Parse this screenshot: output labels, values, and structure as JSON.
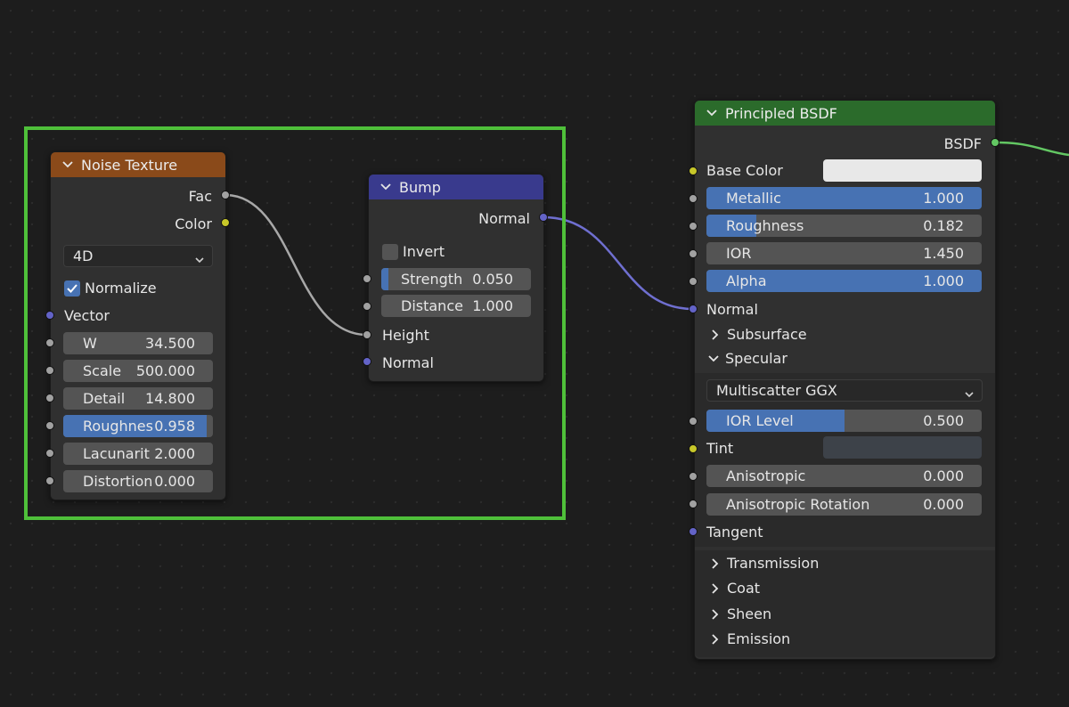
{
  "noise_node": {
    "title": "Noise Texture",
    "header_color": "#8a4a1a",
    "outputs": [
      "Fac",
      "Color"
    ],
    "dimension": "4D",
    "normalize_label": "Normalize",
    "normalize_checked": true,
    "vector_label": "Vector",
    "fields": [
      {
        "label": "W",
        "value": "34.500"
      },
      {
        "label": "Scale",
        "value": "500.000"
      },
      {
        "label": "Detail",
        "value": "14.800"
      },
      {
        "label": "Roughnes",
        "value": "0.958",
        "fill": 0.958
      },
      {
        "label": "Lacunarit",
        "value": "2.000"
      },
      {
        "label": "Distortion",
        "value": "0.000"
      }
    ]
  },
  "bump_node": {
    "title": "Bump",
    "header_color": "#393a8d",
    "output": "Normal",
    "invert_label": "Invert",
    "invert_checked": false,
    "fields": [
      {
        "label": "Strength",
        "value": "0.050",
        "fill": 0.05
      },
      {
        "label": "Distance",
        "value": "1.000"
      }
    ],
    "inputs": [
      "Height",
      "Normal"
    ]
  },
  "bsdf_node": {
    "title": "Principled BSDF",
    "header_color": "#2b6b2b",
    "output": "BSDF",
    "base_color_label": "Base Color",
    "base_color": "#e8e8e8",
    "fields": [
      {
        "label": "Metallic",
        "value": "1.000",
        "fill": 1.0
      },
      {
        "label": "Roughness",
        "value": "0.182",
        "fill": 0.182
      },
      {
        "label": "IOR",
        "value": "1.450"
      },
      {
        "label": "Alpha",
        "value": "1.000",
        "fill": 1.0
      }
    ],
    "normal_label": "Normal",
    "subsurface_label": "Subsurface",
    "specular_label": "Specular",
    "distribution": "Multiscatter GGX",
    "ior_level": {
      "label": "IOR Level",
      "value": "0.500",
      "fill": 0.5
    },
    "tint_label": "Tint",
    "tint_color": "#3d4249",
    "anisotropic": {
      "label": "Anisotropic",
      "value": "0.000"
    },
    "anisotropic_rotation": {
      "label": "Anisotropic Rotation",
      "value": "0.000"
    },
    "tangent_label": "Tangent",
    "sections": [
      "Transmission",
      "Coat",
      "Sheen",
      "Emission"
    ]
  },
  "icons": {
    "collapse": "chevron-down-icon",
    "expand": "chevron-right-icon",
    "check": "checkmark-icon"
  }
}
